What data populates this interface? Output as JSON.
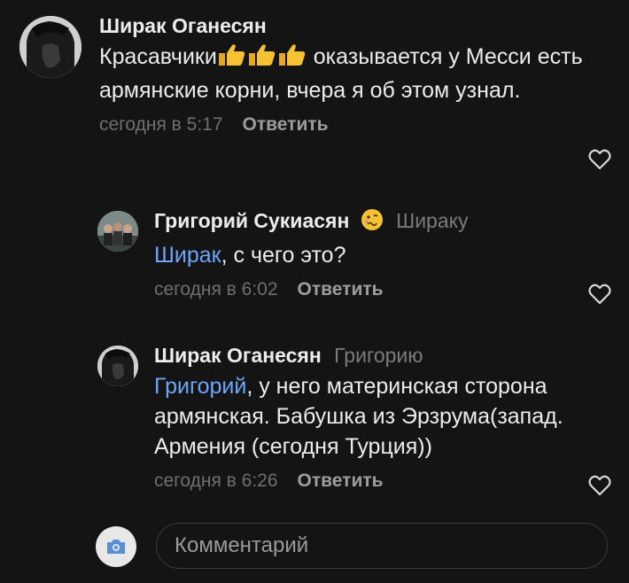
{
  "comments": [
    {
      "author": "Ширак Оганесян",
      "reply_to": "",
      "mention": "",
      "text_before": "Красавчики",
      "text_after": " оказывается у Месси есть армянские корни, вчера я об этом узнал.",
      "emojis": [
        "thumbs-up-icon",
        "thumbs-up-icon",
        "thumbs-up-icon"
      ],
      "time": "сегодня в 5:17",
      "reply_label": "Ответить"
    },
    {
      "author": "Григорий Сукиасян",
      "author_emoji": "woozy-face-icon",
      "reply_to": "Шираку",
      "mention": "Ширак",
      "text": ", с чего это?",
      "time": "сегодня в 6:02",
      "reply_label": "Ответить"
    },
    {
      "author": "Ширак Оганесян",
      "reply_to": "Григорию",
      "mention": "Григорий",
      "text": ", у него материнская сторона армянская. Бабушка из Эрзрума(запад. Армения (сегодня Турция))",
      "time": "сегодня в 6:26",
      "reply_label": "Ответить"
    }
  ],
  "composer": {
    "placeholder": "Комментарий",
    "camera_icon": "camera-icon"
  },
  "colors": {
    "background": "#141414",
    "mention": "#6ea6f5",
    "muted": "#6f6f6f"
  }
}
